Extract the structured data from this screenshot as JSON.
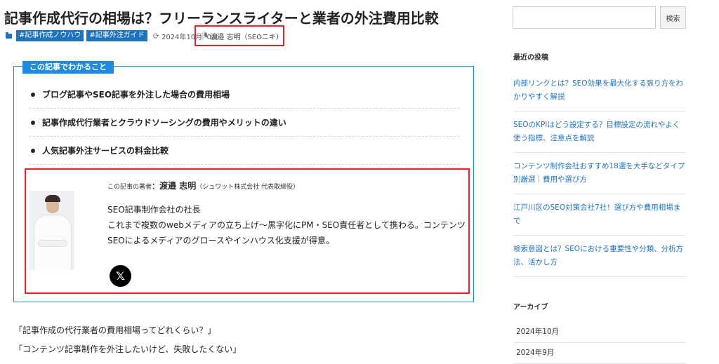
{
  "article": {
    "title": "記事作成代行の相場は？フリーランスライターと業者の外注費用比較",
    "tags": [
      "#記事作成ノウハウ",
      "#記事外注ガイド"
    ],
    "date": "2024年10月10日",
    "author_meta": "渡邉 志明（SEOニキ）"
  },
  "toc": {
    "label": "この記事でわかること",
    "items": [
      "ブログ記事やSEO記事を外注した場合の費用相場",
      "記事作成代行業者とクラウドソーシングの費用やメリットの違い",
      "人気記事外注サービスの料金比較"
    ]
  },
  "author_box": {
    "prefix": "この記事の著者",
    "colon": "：",
    "name": "渡邉 志明",
    "org": "（シュワット株式会社 代表取締役）",
    "bio_line1": "SEO記事制作会社の社長",
    "bio_line2": "これまで複数のwebメディアの立ち上げ〜黒字化にPM・SEO責任者として携わる。コンテンツSEOによるメディアのグロースやインハウス化支援が得意。",
    "x_label": "𝕏"
  },
  "intro": {
    "line1": "「記事作成の代行業者の費用相場ってどれくらい？」",
    "line2": "「コンテンツ記事制作を外注したいけど、失敗したくない」"
  },
  "sidebar": {
    "search_placeholder": "",
    "search_button": "検索",
    "recent_heading": "最近の投稿",
    "recent_posts": [
      "内部リンクとは？SEO効果を最大化する張り方をわかりやすく解説",
      "SEOのKPIはどう設定する？目標設定の流れやよく使う指標、注意点を解説",
      "コンテンツ制作会社おすすめ18選を大手などタイプ別厳選｜費用や選び方",
      "江戸川区のSEO対策会社7社！選び方や費用相場まで",
      "検索意図とは？SEOにおける重要性や分類、分析方法、活かし方"
    ],
    "archive_heading": "アーカイブ",
    "archives": [
      "2024年10月",
      "2024年9月"
    ]
  },
  "colors": {
    "accent_blue": "#1e8be0",
    "tag_blue": "#1e73be",
    "highlight_red": "#e5232b",
    "link_blue": "#1e73be"
  },
  "icons": {
    "category": "folder-icon",
    "updated": "refresh-icon",
    "social": "x-logo-icon"
  }
}
